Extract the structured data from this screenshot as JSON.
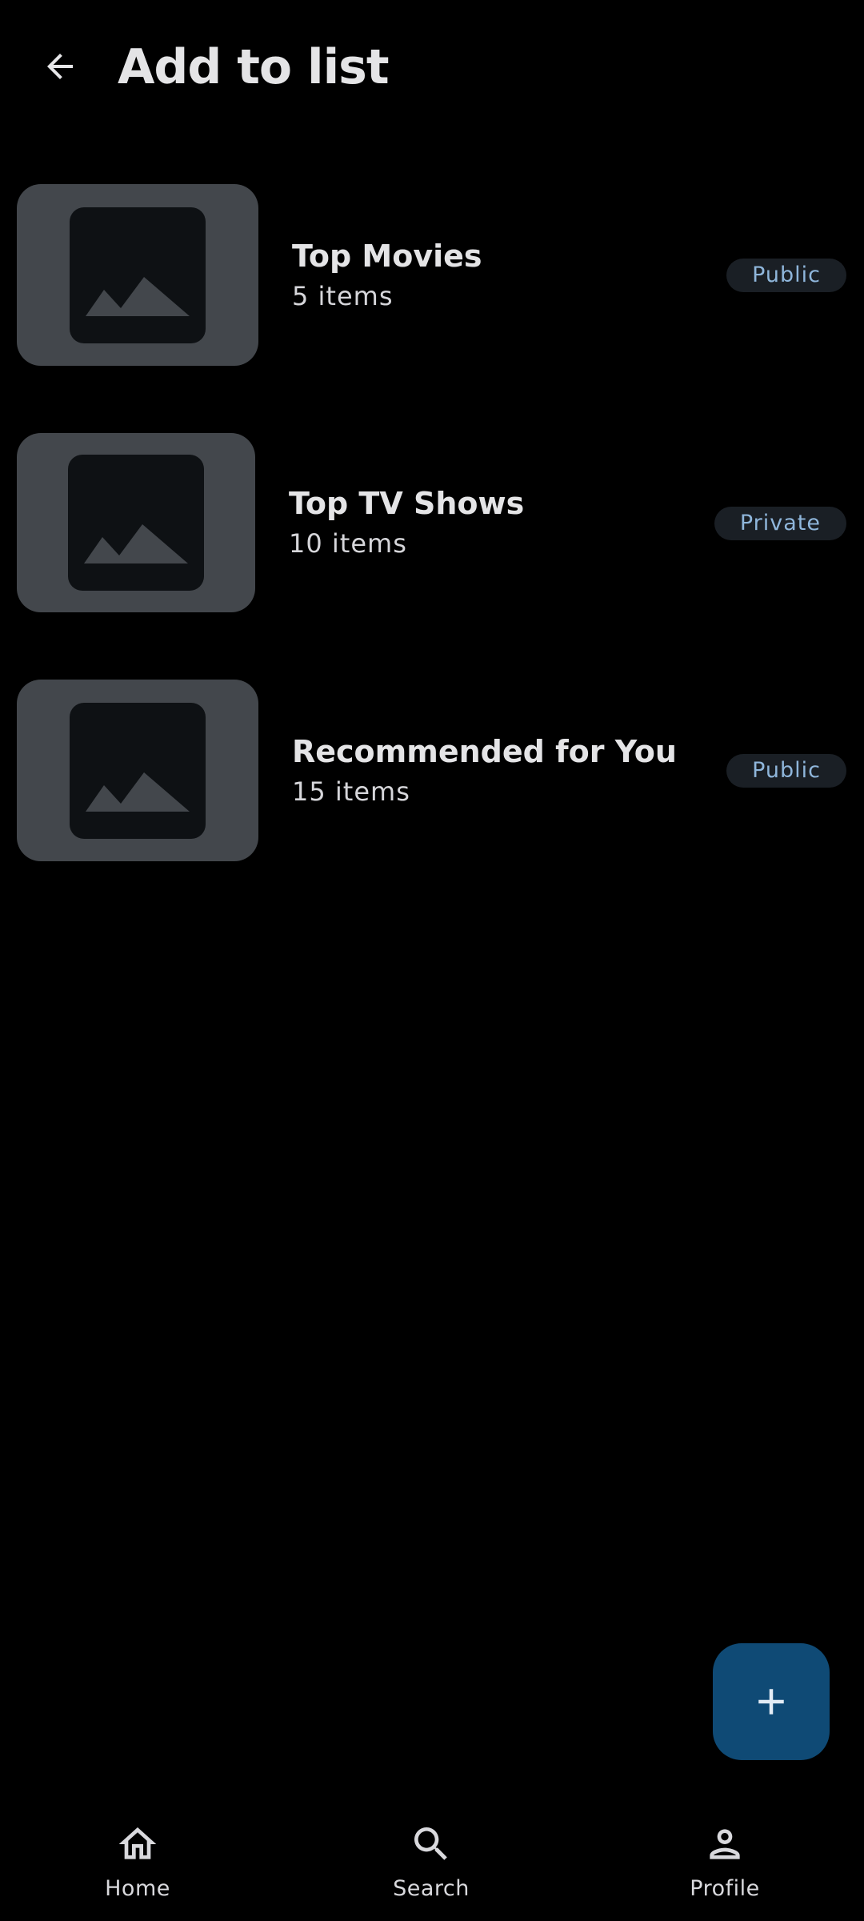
{
  "header": {
    "title": "Add to list",
    "back_icon": "arrow-back-icon"
  },
  "lists": [
    {
      "title": "Top Movies",
      "count": "5 items",
      "visibility": "Public",
      "thumbnail_icon": "image-placeholder-icon"
    },
    {
      "title": "Top TV Shows",
      "count": "10 items",
      "visibility": "Private",
      "thumbnail_icon": "image-placeholder-icon"
    },
    {
      "title": "Recommended for You",
      "count": "15 items",
      "visibility": "Public",
      "thumbnail_icon": "image-placeholder-icon"
    }
  ],
  "fab": {
    "icon": "plus-icon",
    "color": "#0f4a75"
  },
  "bottom_nav": {
    "items": [
      {
        "label": "Home",
        "icon": "home-icon"
      },
      {
        "label": "Search",
        "icon": "search-icon"
      },
      {
        "label": "Profile",
        "icon": "profile-icon"
      }
    ]
  },
  "colors": {
    "background": "#000000",
    "thumbnail": "#43474c",
    "badge_background": "#1a1f25",
    "badge_text": "#8fb6db"
  }
}
